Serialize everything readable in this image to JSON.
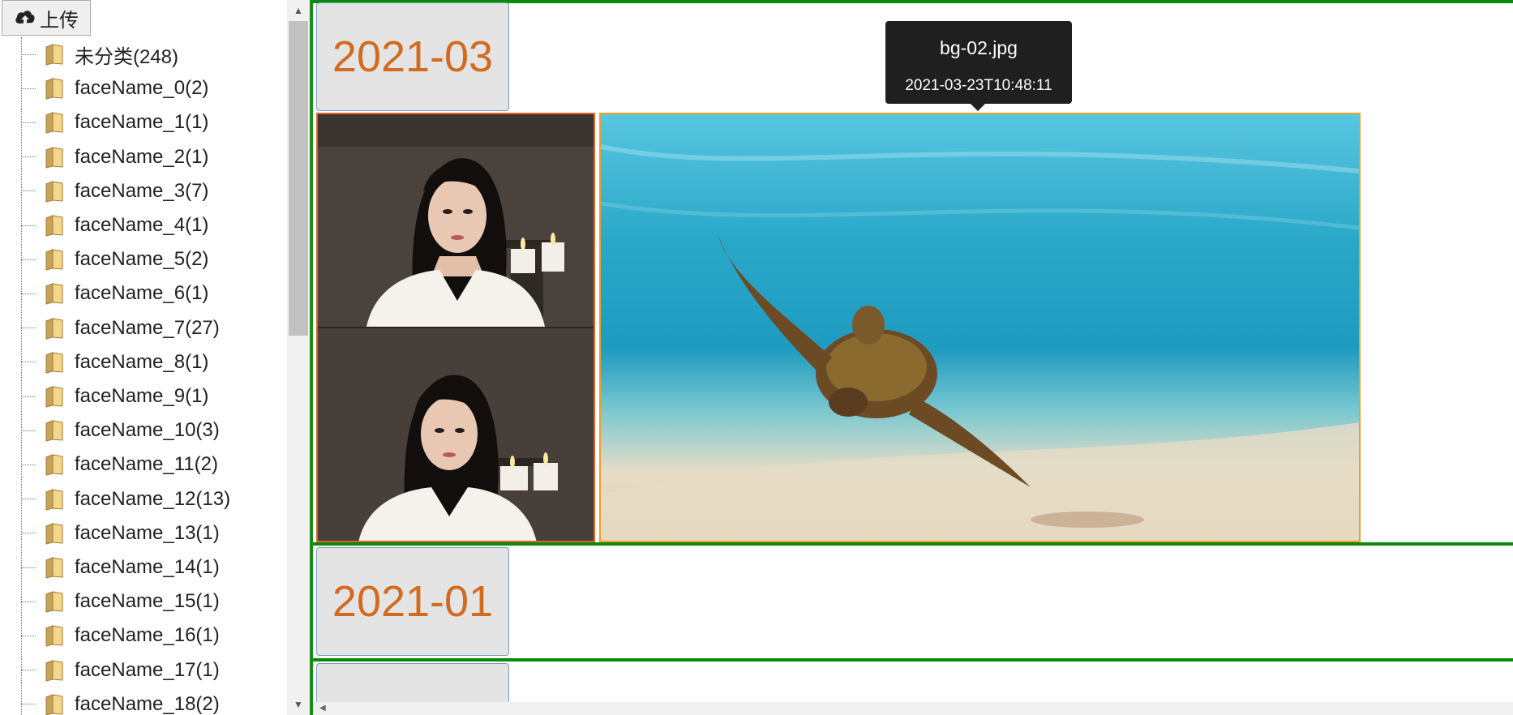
{
  "sidebar": {
    "upload_label": "上传",
    "upload_icon": "cloud-upload-icon",
    "folder_icon": "folder-icon",
    "items": [
      {
        "label": "未分类(248)"
      },
      {
        "label": "faceName_0(2)"
      },
      {
        "label": "faceName_1(1)"
      },
      {
        "label": "faceName_2(1)"
      },
      {
        "label": "faceName_3(7)"
      },
      {
        "label": "faceName_4(1)"
      },
      {
        "label": "faceName_5(2)"
      },
      {
        "label": "faceName_6(1)"
      },
      {
        "label": "faceName_7(27)"
      },
      {
        "label": "faceName_8(1)"
      },
      {
        "label": "faceName_9(1)"
      },
      {
        "label": "faceName_10(3)"
      },
      {
        "label": "faceName_11(2)"
      },
      {
        "label": "faceName_12(13)"
      },
      {
        "label": "faceName_13(1)"
      },
      {
        "label": "faceName_14(1)"
      },
      {
        "label": "faceName_15(1)"
      },
      {
        "label": "faceName_16(1)"
      },
      {
        "label": "faceName_17(1)"
      },
      {
        "label": "faceName_18(2)"
      }
    ]
  },
  "main": {
    "groups": [
      {
        "date": "2021-03"
      },
      {
        "date": "2021-01"
      },
      {
        "date": ""
      }
    ],
    "tooltip": {
      "name": "bg-02.jpg",
      "date": "2021-03-23T10:48:11"
    },
    "delete_icon": "trash-icon"
  },
  "colors": {
    "accent_green": "#0a8a0a",
    "date_orange": "#d26b1f",
    "tooltip_bg": "#1f1f1f"
  }
}
